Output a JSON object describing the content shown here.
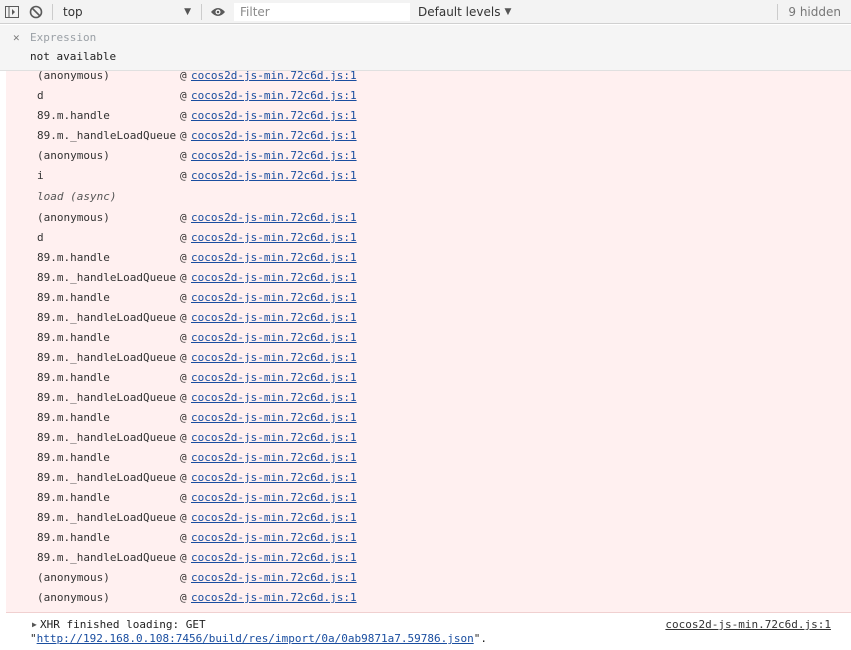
{
  "toolbar": {
    "context": "top",
    "filter_placeholder": "Filter",
    "levels": "Default levels",
    "hidden": "9 hidden"
  },
  "expression": {
    "label": "Expression",
    "value": "not available"
  },
  "stack": {
    "at": "@",
    "frames": [
      {
        "fn": "(anonymous)",
        "link": "cocos2d-js-min.72c6d.js:1"
      },
      {
        "fn": "d",
        "link": "cocos2d-js-min.72c6d.js:1"
      },
      {
        "fn": "89.m.handle",
        "link": "cocos2d-js-min.72c6d.js:1"
      },
      {
        "fn": "89.m._handleLoadQueue",
        "link": "cocos2d-js-min.72c6d.js:1"
      },
      {
        "fn": "(anonymous)",
        "link": "cocos2d-js-min.72c6d.js:1"
      },
      {
        "fn": "i",
        "link": "cocos2d-js-min.72c6d.js:1"
      },
      {
        "fn": "load (async)",
        "async": true
      },
      {
        "fn": "(anonymous)",
        "link": "cocos2d-js-min.72c6d.js:1"
      },
      {
        "fn": "d",
        "link": "cocos2d-js-min.72c6d.js:1"
      },
      {
        "fn": "89.m.handle",
        "link": "cocos2d-js-min.72c6d.js:1"
      },
      {
        "fn": "89.m._handleLoadQueue",
        "link": "cocos2d-js-min.72c6d.js:1"
      },
      {
        "fn": "89.m.handle",
        "link": "cocos2d-js-min.72c6d.js:1"
      },
      {
        "fn": "89.m._handleLoadQueue",
        "link": "cocos2d-js-min.72c6d.js:1"
      },
      {
        "fn": "89.m.handle",
        "link": "cocos2d-js-min.72c6d.js:1"
      },
      {
        "fn": "89.m._handleLoadQueue",
        "link": "cocos2d-js-min.72c6d.js:1"
      },
      {
        "fn": "89.m.handle",
        "link": "cocos2d-js-min.72c6d.js:1"
      },
      {
        "fn": "89.m._handleLoadQueue",
        "link": "cocos2d-js-min.72c6d.js:1"
      },
      {
        "fn": "89.m.handle",
        "link": "cocos2d-js-min.72c6d.js:1"
      },
      {
        "fn": "89.m._handleLoadQueue",
        "link": "cocos2d-js-min.72c6d.js:1"
      },
      {
        "fn": "89.m.handle",
        "link": "cocos2d-js-min.72c6d.js:1"
      },
      {
        "fn": "89.m._handleLoadQueue",
        "link": "cocos2d-js-min.72c6d.js:1"
      },
      {
        "fn": "89.m.handle",
        "link": "cocos2d-js-min.72c6d.js:1"
      },
      {
        "fn": "89.m._handleLoadQueue",
        "link": "cocos2d-js-min.72c6d.js:1"
      },
      {
        "fn": "89.m.handle",
        "link": "cocos2d-js-min.72c6d.js:1"
      },
      {
        "fn": "89.m._handleLoadQueue",
        "link": "cocos2d-js-min.72c6d.js:1"
      },
      {
        "fn": "(anonymous)",
        "link": "cocos2d-js-min.72c6d.js:1"
      },
      {
        "fn": "(anonymous)",
        "link": "cocos2d-js-min.72c6d.js:1"
      }
    ]
  },
  "xhr": {
    "message": "XHR finished loading: GET",
    "url_open": "\"",
    "url": "http://192.168.0.108:7456/build/res/import/0a/0ab9871a7.59786.json",
    "url_close": "\".",
    "source": "cocos2d-js-min.72c6d.js:1"
  }
}
